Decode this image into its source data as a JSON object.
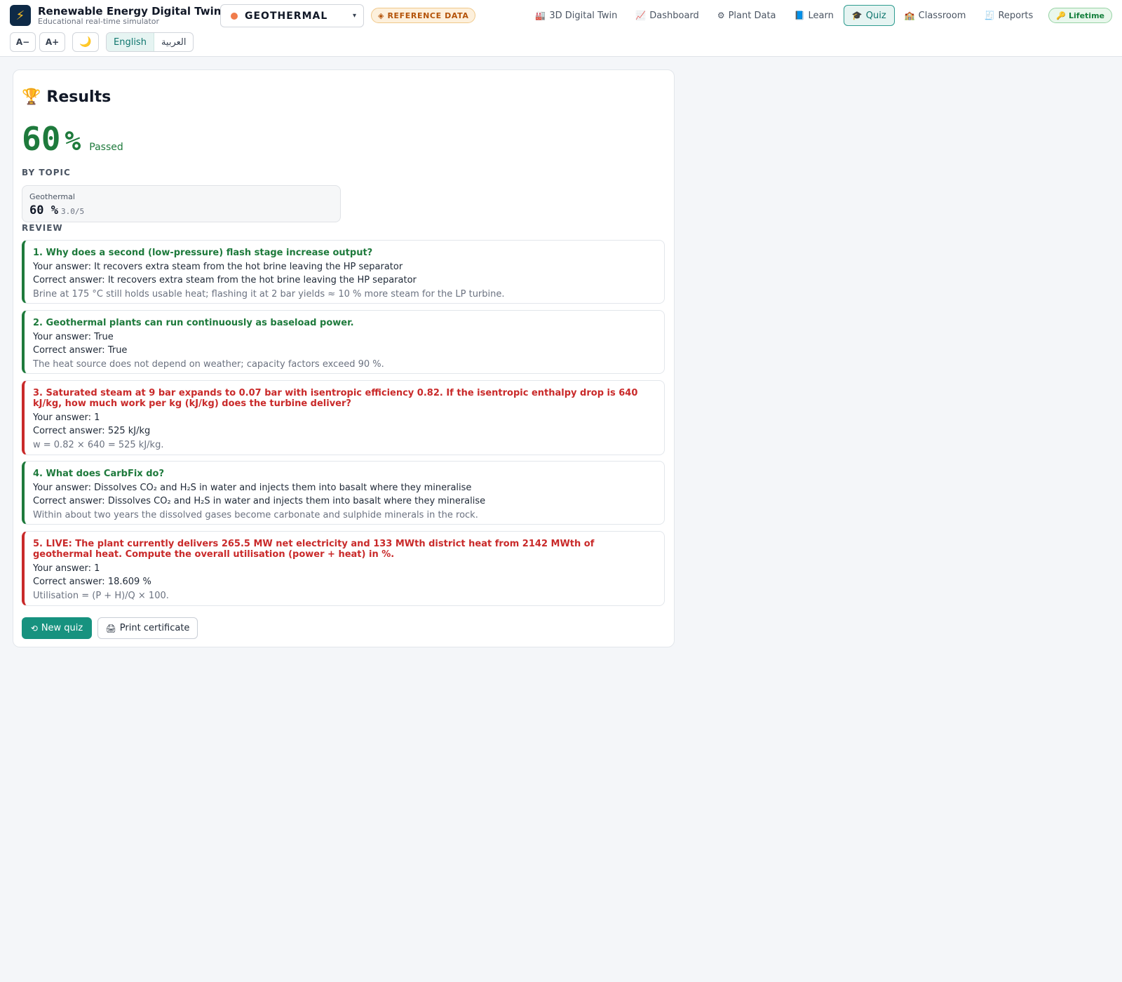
{
  "header": {
    "app_title": "Renewable Energy Digital Twin",
    "app_subtitle": "Educational real-time simulator",
    "plant": {
      "name": "GEOTHERMAL",
      "caret": "▾",
      "dot_color": "#f07c4b"
    },
    "reference_badge": "◈ REFERENCE DATA",
    "nav": [
      {
        "icon": "🏭",
        "label": "3D Digital Twin"
      },
      {
        "icon": "📈",
        "label": "Dashboard"
      },
      {
        "icon": "⚙",
        "label": "Plant Data"
      },
      {
        "icon": "📘",
        "label": "Learn"
      },
      {
        "icon": "🎓",
        "label": "Quiz",
        "active": true
      },
      {
        "icon": "🏫",
        "label": "Classroom"
      },
      {
        "icon": "🧾",
        "label": "Reports"
      }
    ],
    "lifetime": {
      "icon": "🔑",
      "label": "Lifetime"
    },
    "tools": {
      "font_decrease": "A−",
      "font_increase": "A+",
      "theme_icon": "🌙"
    },
    "languages": [
      "English",
      "العربية"
    ],
    "active_language": "English"
  },
  "results": {
    "title_icon": "🏆",
    "title": "Results",
    "score_value": "60",
    "score_unit": "%",
    "status": "Passed",
    "by_topic_label": "BY TOPIC",
    "topics": [
      {
        "name": "Geothermal",
        "pct": "60 %",
        "count": "3.0/5"
      }
    ],
    "review_label": "REVIEW",
    "review": [
      {
        "status": "correct",
        "question": "1. Why does a second (low-pressure) flash stage increase output?",
        "your_answer": "Your answer: It recovers extra steam from the hot brine leaving the HP separator",
        "correct_answer": "Correct answer: It recovers extra steam from the hot brine leaving the HP separator",
        "explanation": "Brine at 175 °C still holds usable heat; flashing it at 2 bar yields ≈ 10 % more steam for the LP turbine."
      },
      {
        "status": "correct",
        "question": "2. Geothermal plants can run continuously as baseload power.",
        "your_answer": "Your answer: True",
        "correct_answer": "Correct answer: True",
        "explanation": "The heat source does not depend on weather; capacity factors exceed 90 %."
      },
      {
        "status": "wrong",
        "question": "3. Saturated steam at 9 bar expands to 0.07 bar with isentropic efficiency 0.82. If the isentropic enthalpy drop is 640 kJ/kg, how much work per kg (kJ/kg) does the turbine deliver?",
        "your_answer": "Your answer: 1",
        "correct_answer": "Correct answer: 525 kJ/kg",
        "explanation": "w = 0.82 × 640 = 525 kJ/kg."
      },
      {
        "status": "correct",
        "question": "4. What does CarbFix do?",
        "your_answer": "Your answer: Dissolves CO₂ and H₂S in water and injects them into basalt where they mineralise",
        "correct_answer": "Correct answer: Dissolves CO₂ and H₂S in water and injects them into basalt where they mineralise",
        "explanation": "Within about two years the dissolved gases become carbonate and sulphide minerals in the rock."
      },
      {
        "status": "wrong",
        "question": "5. LIVE: The plant currently delivers 265.5 MW net electricity and 133 MWth district heat from 2142 MWth of geothermal heat. Compute the overall utilisation (power + heat) in %.",
        "your_answer": "Your answer: 1",
        "correct_answer": "Correct answer: 18.609 %",
        "explanation": "Utilisation = (P + H)/Q × 100."
      }
    ],
    "buttons": {
      "new_quiz_icon": "⟲",
      "new_quiz": "New quiz",
      "print_icon": "🖨",
      "print": "Print certificate"
    }
  }
}
